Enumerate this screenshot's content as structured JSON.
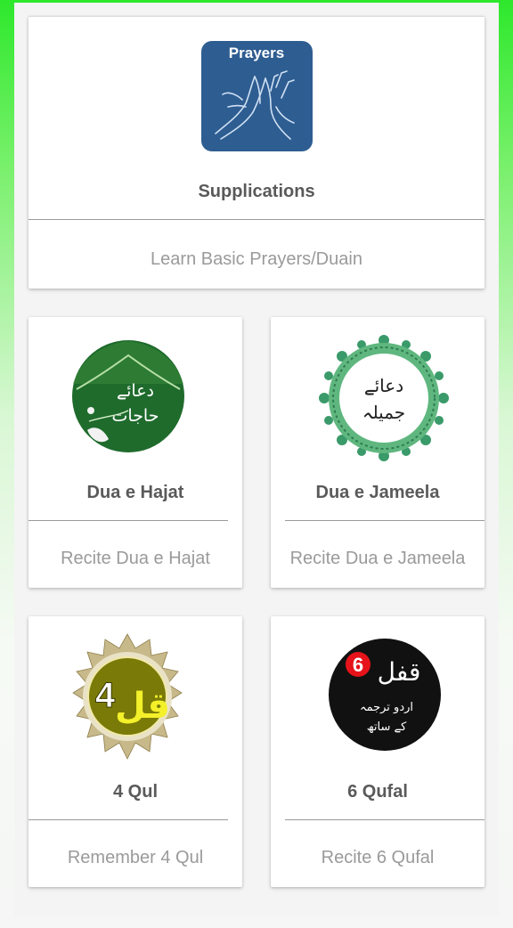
{
  "featured": {
    "icon_label": "Prayers",
    "icon": "praying-hands-icon",
    "title": "Supplications",
    "subtitle": "Learn Basic Prayers/Duain"
  },
  "cards": [
    {
      "title": "Dua e Hajat",
      "subtitle": "Recite Dua e Hajat",
      "icon": "dua-e-hajat-icon"
    },
    {
      "title": "Dua e Jameela",
      "subtitle": "Recite Dua e Jameela",
      "icon": "dua-e-jameela-icon"
    },
    {
      "title": "4 Qul",
      "subtitle": "Remember 4 Qul",
      "icon": "4-qul-icon"
    },
    {
      "title": "6 Qufal",
      "subtitle": "Recite 6 Qufal",
      "icon": "6-qufal-icon"
    }
  ],
  "colors": {
    "background_top": "#2ee82c",
    "title_text": "#5a5a5a",
    "subtitle_text": "#9a9a9a",
    "prayers_tile": "#2e5d91"
  }
}
